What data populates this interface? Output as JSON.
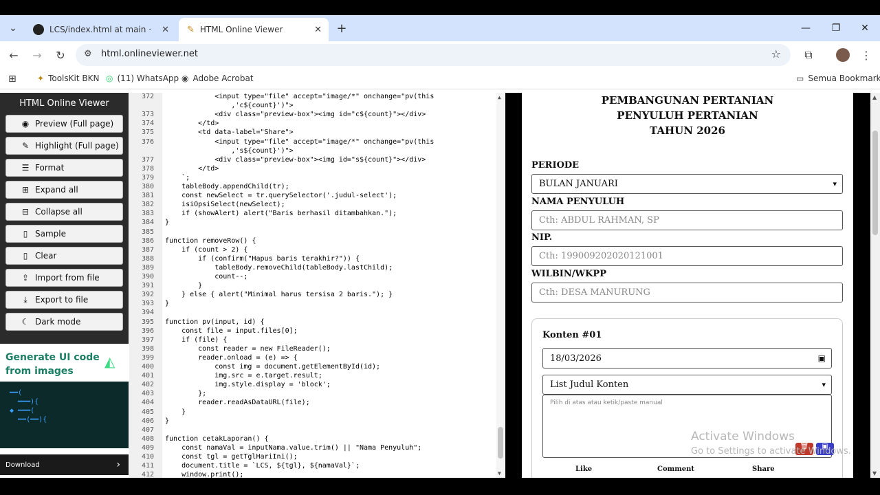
{
  "browser": {
    "tabs": [
      {
        "label": "LCS/index.html at main · mama",
        "icon": "github-icon"
      },
      {
        "label": "HTML Online Viewer",
        "icon": "pencil-icon"
      }
    ],
    "url": "html.onlineviewer.net",
    "bookmarks": [
      "ToolsKit BKN",
      "(11) WhatsApp",
      "Adobe Acrobat"
    ],
    "all_bookmarks": "Semua Bookmark"
  },
  "sidebar": {
    "title": "HTML Online Viewer",
    "buttons": [
      "Preview (Full page)",
      "Highlight (Full page)",
      "Format",
      "Expand all",
      "Collapse all",
      "Sample",
      "Clear",
      "Import from file",
      "Export to file",
      "Dark mode"
    ],
    "ad_title": "Generate UI code from images",
    "ad_cta": "Download"
  },
  "editor": {
    "lines": [
      {
        "n": "372",
        "code": "            <input type=\"file\" accept=\"image/*\" onchange=\"pv(this"
      },
      {
        "n": "",
        "code": "                ,'c${count}')\">"
      },
      {
        "n": "373",
        "code": "            <div class=\"preview-box\"><img id=\"c${count}\"></div>"
      },
      {
        "n": "374",
        "code": "        </td>"
      },
      {
        "n": "375",
        "code": "        <td data-label=\"Share\">"
      },
      {
        "n": "376",
        "code": "            <input type=\"file\" accept=\"image/*\" onchange=\"pv(this"
      },
      {
        "n": "",
        "code": "                ,'s${count}')\">"
      },
      {
        "n": "377",
        "code": "            <div class=\"preview-box\"><img id=\"s${count}\"></div>"
      },
      {
        "n": "378",
        "code": "        </td>"
      },
      {
        "n": "379",
        "code": "    `;"
      },
      {
        "n": "380",
        "code": "    tableBody.appendChild(tr);"
      },
      {
        "n": "381",
        "code": "    const newSelect = tr.querySelector('.judul-select');"
      },
      {
        "n": "382",
        "code": "    isiOpsiSelect(newSelect);"
      },
      {
        "n": "383",
        "code": "    if (showAlert) alert(\"Baris berhasil ditambahkan.\");"
      },
      {
        "n": "384",
        "code": "}"
      },
      {
        "n": "385",
        "code": ""
      },
      {
        "n": "386",
        "code": "function removeRow() {"
      },
      {
        "n": "387",
        "code": "    if (count > 2) {"
      },
      {
        "n": "388",
        "code": "        if (confirm(\"Hapus baris terakhir?\")) {"
      },
      {
        "n": "389",
        "code": "            tableBody.removeChild(tableBody.lastChild);"
      },
      {
        "n": "390",
        "code": "            count--;"
      },
      {
        "n": "391",
        "code": "        }"
      },
      {
        "n": "392",
        "code": "    } else { alert(\"Minimal harus tersisa 2 baris.\"); }"
      },
      {
        "n": "393",
        "code": "}"
      },
      {
        "n": "394",
        "code": ""
      },
      {
        "n": "395",
        "code": "function pv(input, id) {"
      },
      {
        "n": "396",
        "code": "    const file = input.files[0];"
      },
      {
        "n": "397",
        "code": "    if (file) {"
      },
      {
        "n": "398",
        "code": "        const reader = new FileReader();"
      },
      {
        "n": "399",
        "code": "        reader.onload = (e) => {"
      },
      {
        "n": "400",
        "code": "            const img = document.getElementById(id);"
      },
      {
        "n": "401",
        "code": "            img.src = e.target.result;"
      },
      {
        "n": "402",
        "code": "            img.style.display = 'block';"
      },
      {
        "n": "403",
        "code": "        };"
      },
      {
        "n": "404",
        "code": "        reader.readAsDataURL(file);"
      },
      {
        "n": "405",
        "code": "    }"
      },
      {
        "n": "406",
        "code": "}"
      },
      {
        "n": "407",
        "code": ""
      },
      {
        "n": "408",
        "code": "function cetakLaporan() {"
      },
      {
        "n": "409",
        "code": "    const namaVal = inputNama.value.trim() || \"Nama Penyuluh\";"
      },
      {
        "n": "410",
        "code": "    const tgl = getTglHariIni();"
      },
      {
        "n": "411",
        "code": "    document.title = `LCS, ${tgl}, ${namaVal}`;"
      },
      {
        "n": "412",
        "code": "    window.print();"
      }
    ]
  },
  "preview": {
    "title_lines": [
      "PEMBANGUNAN PERTANIAN",
      "PENYULUH PERTANIAN",
      "TAHUN 2026"
    ],
    "periode_label": "PERIODE",
    "periode_value": "BULAN JANUARI",
    "nama_label": "NAMA PENYULUH",
    "nama_placeholder": "Cth: ABDUL RAHMAN, SP",
    "nip_label": "NIP.",
    "nip_placeholder": "Cth: 199009202020121001",
    "wilbin_label": "WILBIN/WKPP",
    "wilbin_placeholder": "Cth: DESA MANURUNG",
    "konten_title": "Konten #01",
    "konten_date": "18/03/2026",
    "konten_select": "List Judul Konten",
    "konten_textarea_placeholder": "Pilih di atas atau ketik/paste manual",
    "columns": [
      "Like",
      "Comment",
      "Share"
    ]
  },
  "watermark": {
    "line1": "Activate Windows",
    "line2": "Go to Settings to activate Windows."
  }
}
